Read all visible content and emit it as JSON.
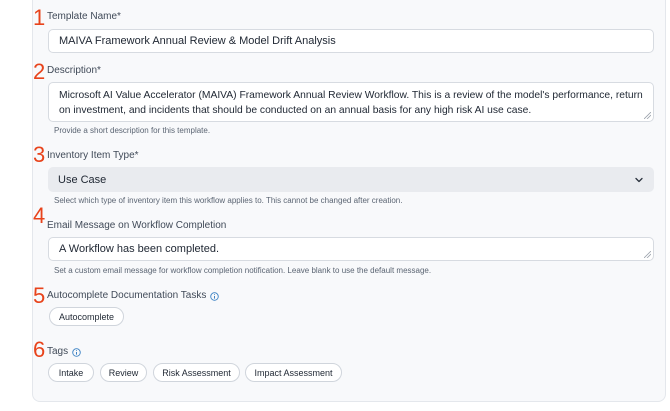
{
  "steps": [
    "1",
    "2",
    "3",
    "4",
    "5",
    "6"
  ],
  "template_name": {
    "label": "Template Name*",
    "value": "MAIVA Framework Annual Review & Model Drift Analysis"
  },
  "description": {
    "label": "Description*",
    "value": "Microsoft AI Value Accelerator (MAIVA) Framework Annual Review Workflow. This is a review of the model's performance, return on investment, and incidents that should be conducted on an annual basis for any high risk AI use case.",
    "helper": "Provide a short description for this template."
  },
  "inventory_item_type": {
    "label": "Inventory Item Type*",
    "value": "Use Case",
    "icon": "chevron-down-icon",
    "helper": "Select which type of inventory item this workflow applies to. This cannot be changed after creation."
  },
  "email_message": {
    "label": "Email Message on Workflow Completion",
    "value": "A Workflow has been completed.",
    "helper": "Set a custom email message for workflow completion notification. Leave blank to use the default message."
  },
  "autocomplete_tasks": {
    "label": "Autocomplete Documentation Tasks",
    "icon": "info-icon",
    "button": "Autocomplete"
  },
  "tags": {
    "label": "Tags",
    "icon": "info-icon",
    "items": [
      "Intake",
      "Review",
      "Risk Assessment",
      "Impact Assessment"
    ]
  },
  "colors": {
    "step_number": "#e8431b",
    "info_icon": "#3b82c4",
    "select_background": "#e9ebef"
  }
}
